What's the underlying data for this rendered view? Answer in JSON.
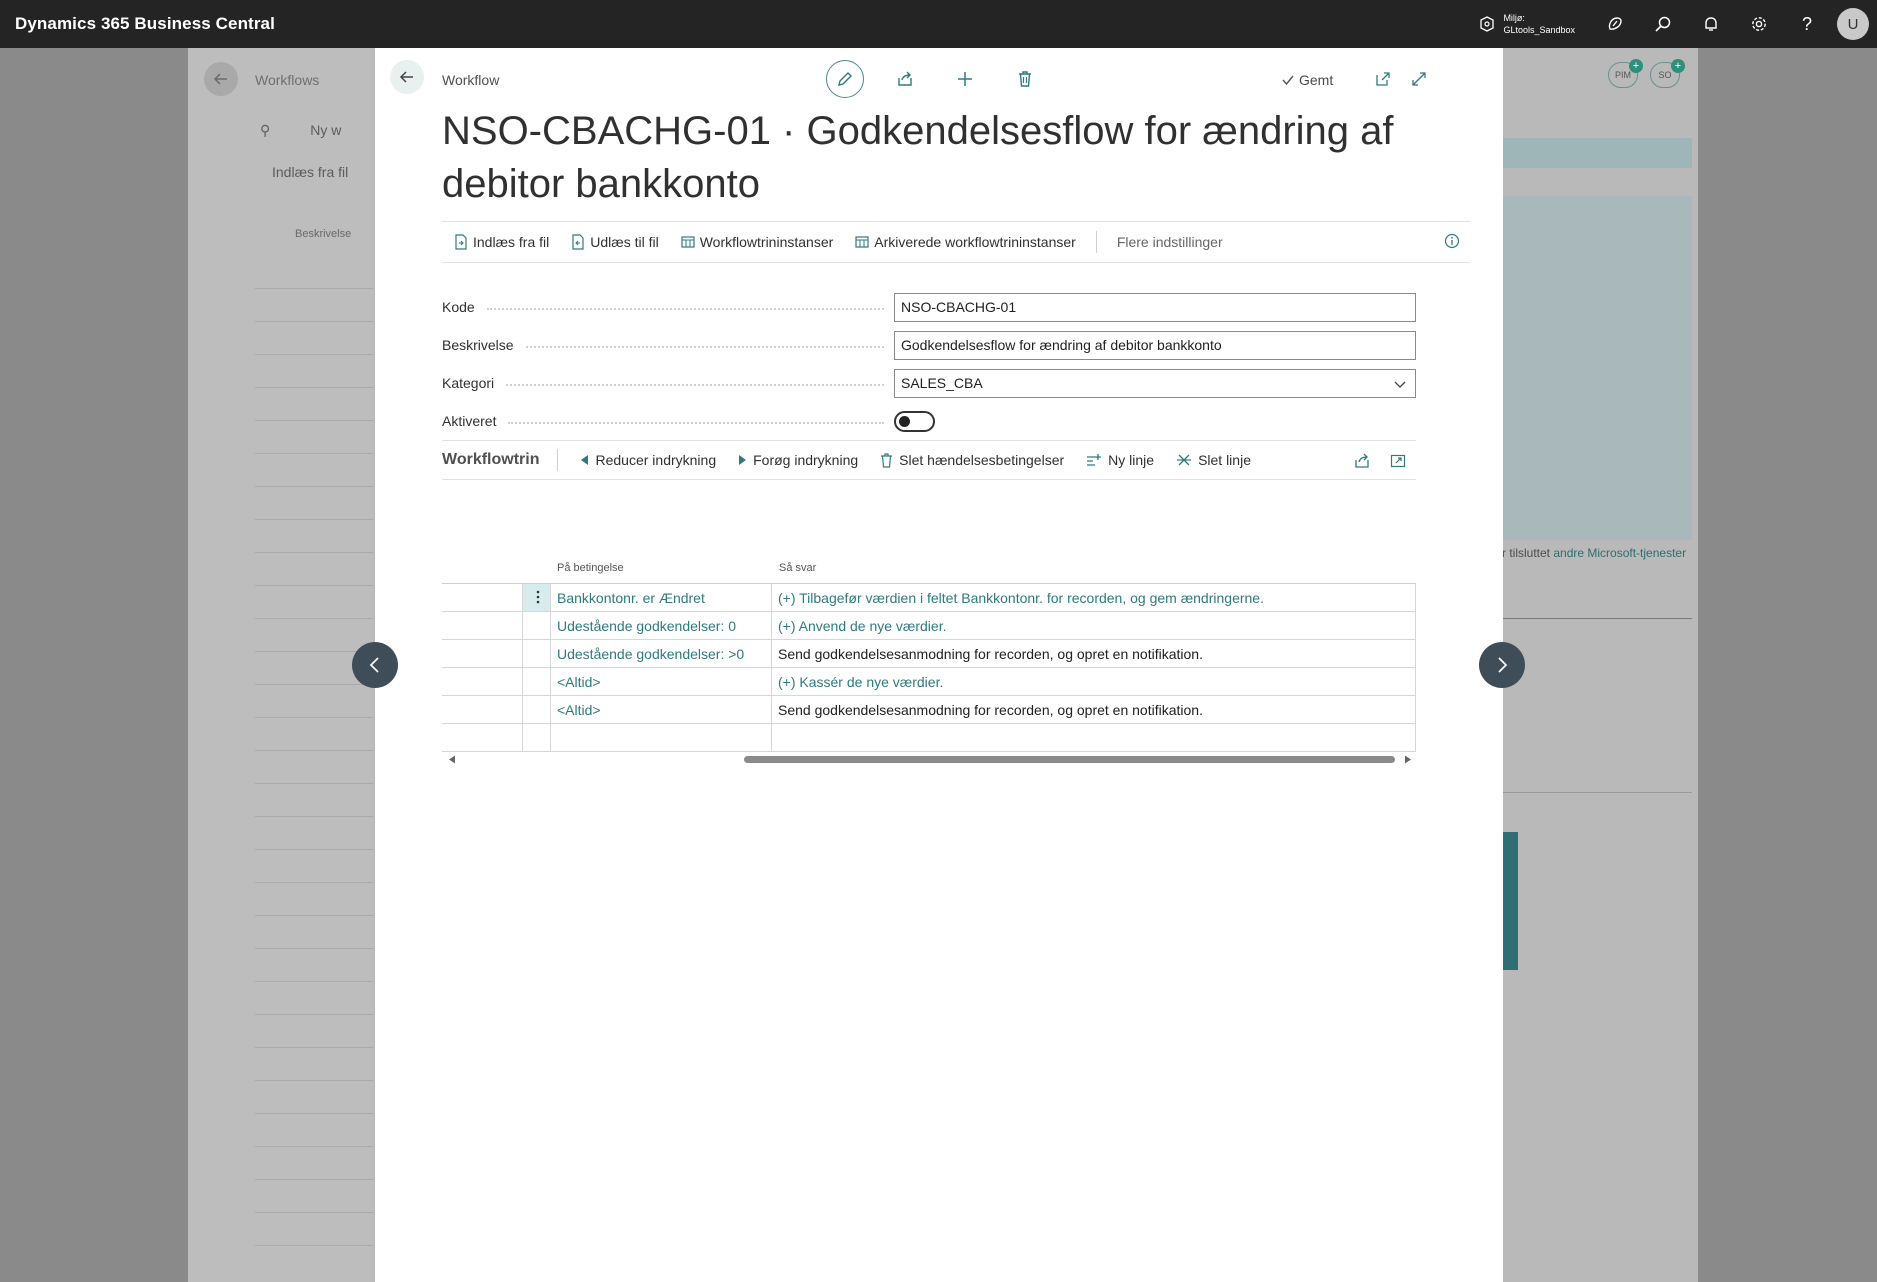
{
  "app": {
    "title": "Dynamics 365 Business Central",
    "environment_line1": "Miljø:",
    "environment_line2": "GLtools_Sandbox",
    "avatar_initial": "U"
  },
  "background": {
    "page_title": "Workflows",
    "toolbar_new": "Ny w",
    "toolbar_import": "Indlæs fra fil",
    "column_description": "Beskrivelse",
    "pill_1": "PIM",
    "pill_2": "SO",
    "footer_text_prefix": "r tilsluttet ",
    "footer_link": "andre Microsoft-tjenester"
  },
  "modal": {
    "breadcrumb": "Workflow",
    "saved_label": "Gemt",
    "title": "NSO-CBACHG-01 · Godkendelsesflow for ændring af debitor bankkonto",
    "toolbar": {
      "import_from_file": "Indlæs fra fil",
      "export_to_file": "Udlæs til fil",
      "step_instances": "Workflowtrininstanser",
      "archived_instances": "Arkiverede workflowtrininstanser",
      "more_options": "Flere indstillinger"
    },
    "fields": {
      "code_label": "Kode",
      "code_value": "NSO-CBACHG-01",
      "description_label": "Beskrivelse",
      "description_value": "Godkendelsesflow for ændring af debitor bankkonto",
      "category_label": "Kategori",
      "category_value": "SALES_CBA",
      "enabled_label": "Aktiveret",
      "enabled_value": false
    },
    "workflow_steps": {
      "title": "Workflowtrin",
      "decrease_indent": "Reducer indrykning",
      "increase_indent": "Forøg indrykning",
      "delete_event_conditions": "Slet hændelsesbetingelser",
      "new_line": "Ny linje",
      "delete_line": "Slet linje",
      "col_condition": "På betingelse",
      "col_response": "Så svar",
      "rows": [
        {
          "condition": "Bankkontonr. er Ændret",
          "response": "(+) Tilbagefør værdien i feltet Bankkontonr. for recorden, og gem ændringerne.",
          "response_link": true
        },
        {
          "condition": "Udestående godkendelser: 0",
          "response": "(+) Anvend de nye værdier.",
          "response_link": true
        },
        {
          "condition": "Udestående godkendelser: >0",
          "response": "Send godkendelsesanmodning for recorden, og opret en notifikation.",
          "response_link": false
        },
        {
          "condition": "<Altid>",
          "response": "(+) Kassér de nye værdier.",
          "response_link": true
        },
        {
          "condition": "<Altid>",
          "response": "Send godkendelsesanmodning for recorden, og opret en notifikation.",
          "response_link": false
        },
        {
          "condition": "",
          "response": "",
          "response_link": false
        }
      ]
    }
  },
  "colors": {
    "accent": "#2f7a7e",
    "appbar": "#242424",
    "nav_arrow": "#3f4d58"
  }
}
